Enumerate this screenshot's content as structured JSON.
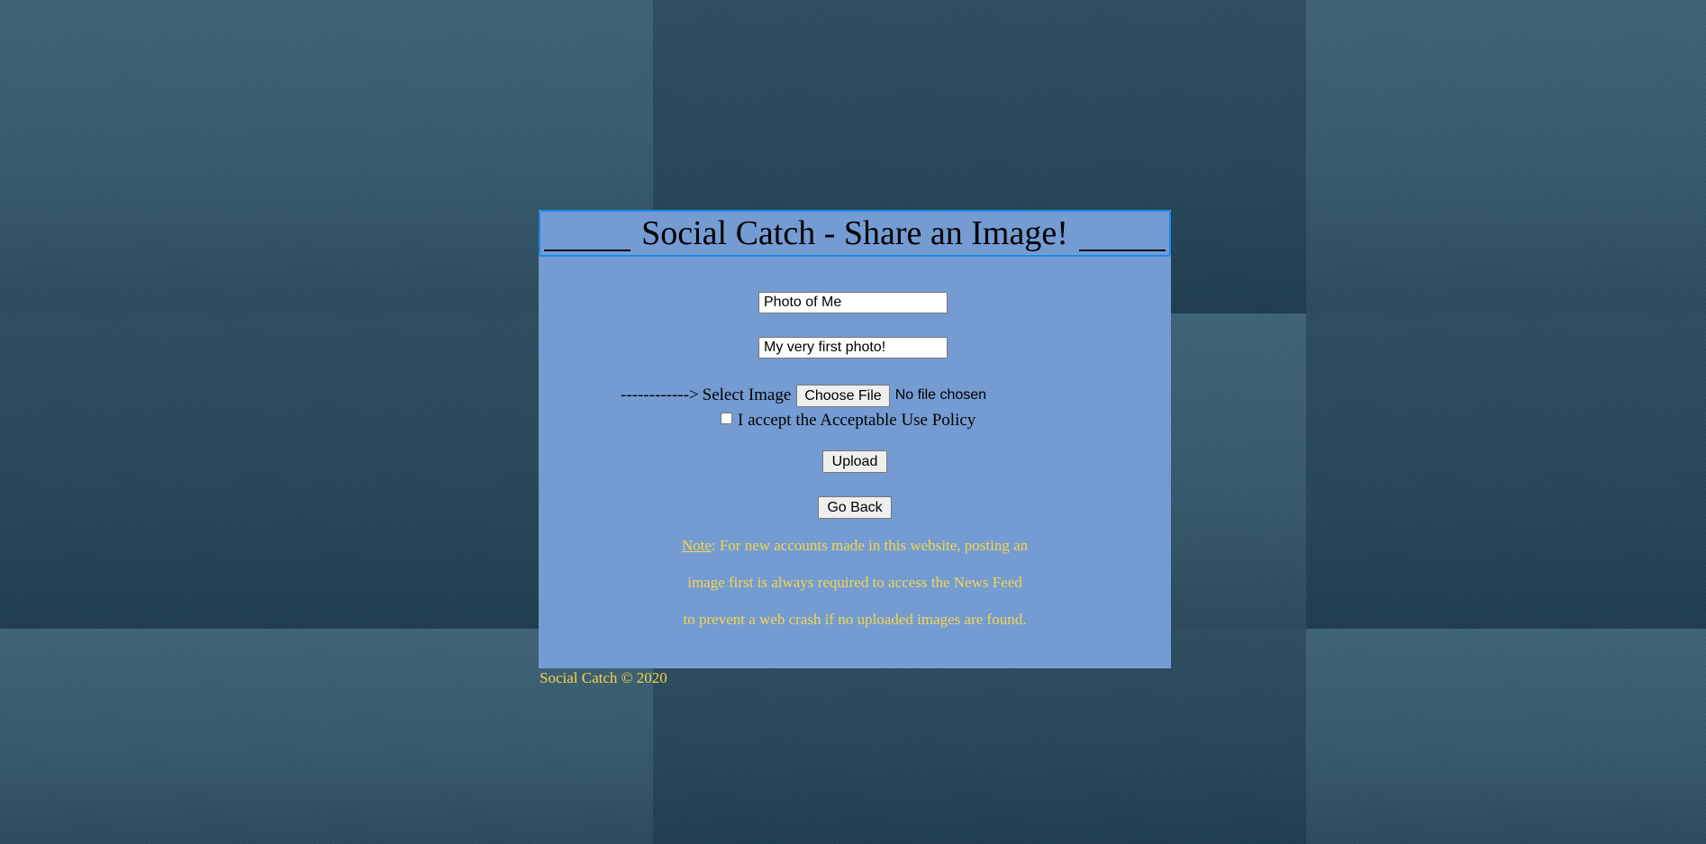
{
  "header": {
    "title": "Social Catch - Share an Image!"
  },
  "form": {
    "title_input_value": "Photo of Me",
    "caption_input_value": "My very first photo!",
    "file_arrow": "------------>",
    "file_label": "Select Image",
    "choose_file_label": "Choose File",
    "no_file_text": "No file chosen",
    "policy_checked": false,
    "policy_label": "I accept the Acceptable Use Policy",
    "upload_label": "Upload",
    "go_back_label": "Go Back"
  },
  "note": {
    "label": "Note",
    "line1_rest": ": For new accounts made in this website, posting an",
    "line2": "image first is always required to access the News Feed",
    "line3": "to prevent a web crash if no uploaded images are found."
  },
  "footer": {
    "text": "Social Catch © 2020"
  },
  "colors": {
    "panel_bg": "#749cd3",
    "header_border": "#1a8be6",
    "note_text": "#f5d64c",
    "page_bg": "#2f5366"
  }
}
